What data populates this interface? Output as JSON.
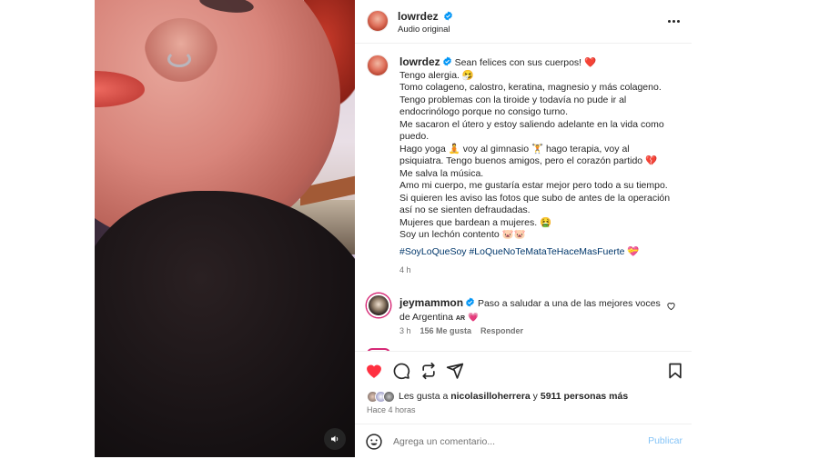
{
  "post": {
    "author": "lowrdez",
    "audio": "Audio original",
    "caption_lines": [
      "Sean felices con sus cuerpos! ❤️",
      "Tengo alergia. 🤧",
      "Tomo colageno, calostro, keratina, magnesio y más colageno.",
      "Tengo problemas con la tiroide y todavía no pude ir al",
      "endocrinólogo porque no consigo turno.",
      "Me sacaron el útero y estoy saliendo adelante en la vida como",
      "puedo.",
      "Hago yoga 🧘 voy al gimnasio 🏋️ hago terapia, voy al",
      "psiquiatra. Tengo buenos amigos, pero el corazón partido 💔",
      "Me salva la música.",
      "Amo mi cuerpo, me gustaría estar mejor pero todo a su tiempo.",
      "Si quieren les aviso las fotos que subo de antes de la operación",
      "así no se sienten defraudadas.",
      "Mujeres que bardean a mujeres. 🤮",
      "Soy un lechón contento 🐷🐷"
    ],
    "hashtags": "#SoyLoQueSoy #LoQueNoTeMataTeHaceMasFuerte 💝",
    "caption_time": "4 h",
    "likes_prefix": "Les gusta a ",
    "likes_user": "nicolasilloherrera",
    "likes_mid": " y ",
    "likes_count": "5911 personas más",
    "posted_ago": "Hace 4 horas"
  },
  "comment": {
    "author": "jeymammon",
    "text": "Paso a saludar a una de las mejores voces de Argentina",
    "flag": "AR",
    "emoji": "💗",
    "time": "3 h",
    "likes": "156 Me gusta",
    "reply_label": "Responder"
  },
  "composer": {
    "placeholder": "Agrega un comentario...",
    "publish_label": "Publicar"
  },
  "colors": {
    "like_red": "#ff3040",
    "verified_blue": "#0095f6",
    "link_blue": "#00376b",
    "publish_blue": "#85c4f7"
  },
  "icons": [
    "verified-icon",
    "more-icon",
    "heart-icon",
    "comment-icon",
    "repost-icon",
    "send-icon",
    "bookmark-icon",
    "emoji-icon",
    "sound-icon"
  ]
}
